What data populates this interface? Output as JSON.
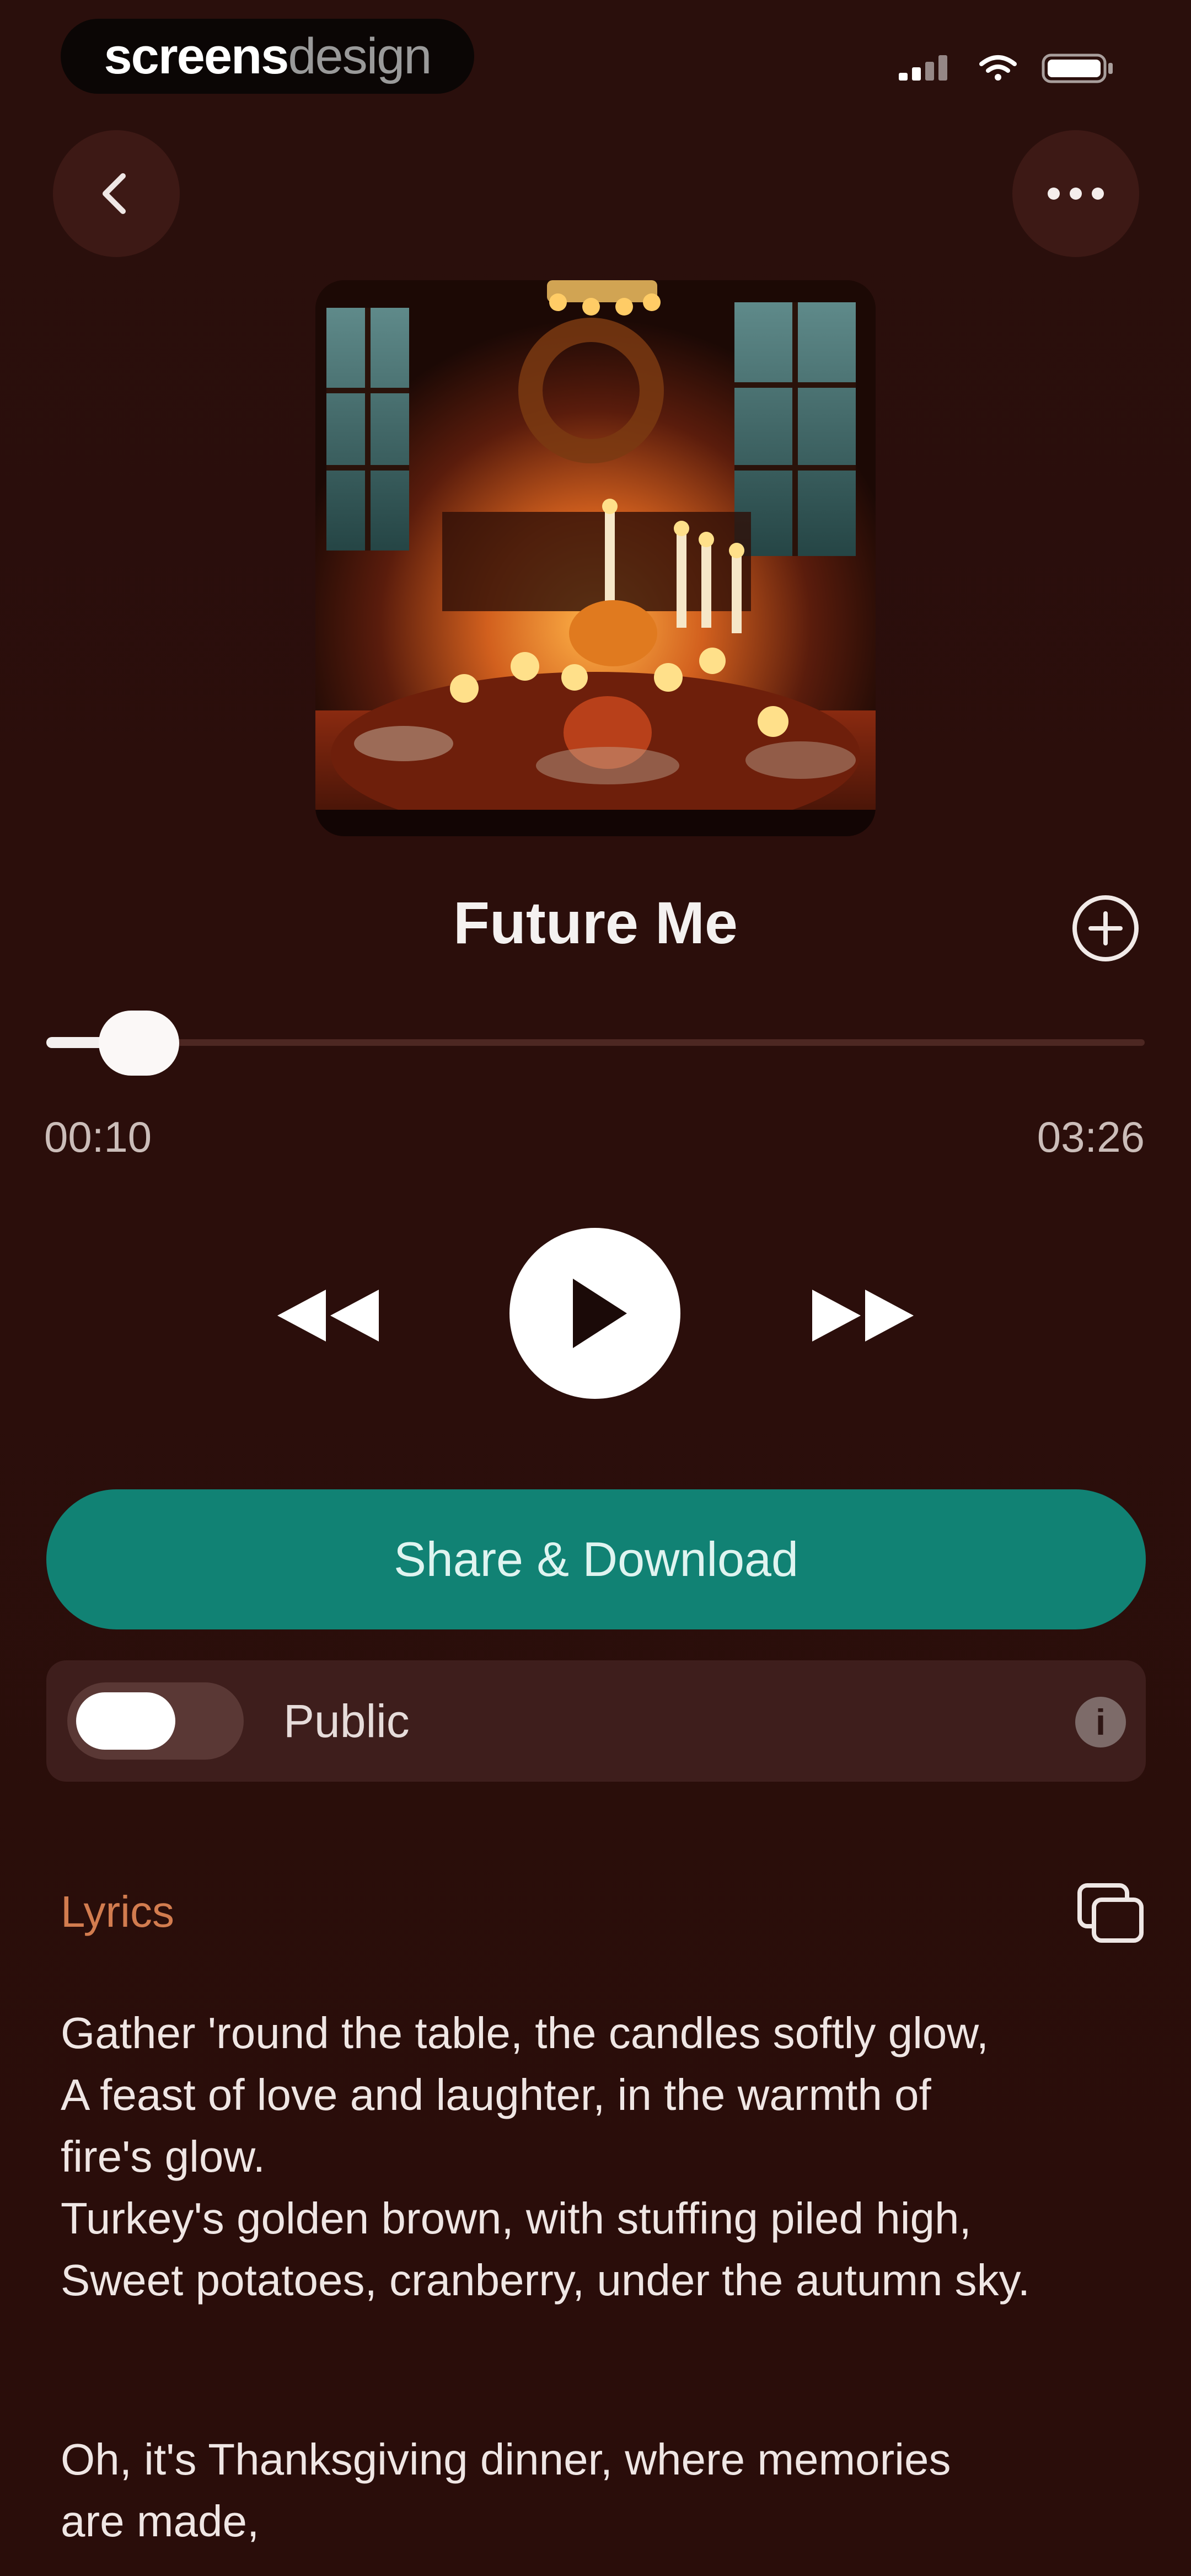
{
  "brand": {
    "part1": "screens",
    "part2": "design"
  },
  "song": {
    "title": "Future Me"
  },
  "progress": {
    "current": "00:10",
    "total": "03:26",
    "fraction": 0.049
  },
  "actions": {
    "share_label": "Share & Download"
  },
  "visibility": {
    "label": "Public",
    "enabled": false
  },
  "lyrics": {
    "label": "Lyrics",
    "stanza1": [
      "Gather 'round the table, the candles softly glow,",
      "A feast of love and laughter, in the warmth of",
      "fire's glow.",
      "Turkey's golden brown, with stuffing piled high,",
      "Sweet potatoes, cranberry, under the autumn sky."
    ],
    "stanza2": [
      "Oh, it's Thanksgiving dinner, where memories",
      "are made,"
    ]
  },
  "icons": {
    "back": "chevron-left-icon",
    "more": "ellipsis-icon",
    "add": "plus-circle-icon",
    "rewind": "rewind-icon",
    "play": "play-icon",
    "forward": "fast-forward-icon",
    "info": "info-icon",
    "copy": "copy-icon"
  },
  "colors": {
    "background": "#2a0f0c",
    "accent": "#118274",
    "lyrics_label": "#d27c4f"
  }
}
